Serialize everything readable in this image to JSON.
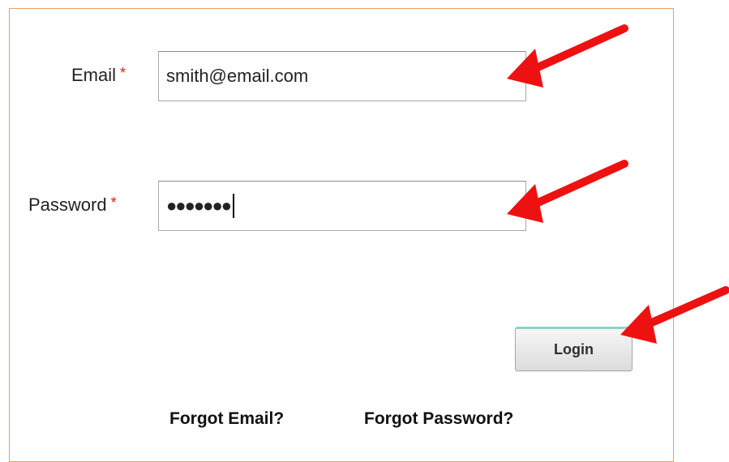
{
  "form": {
    "email_label": "Email",
    "password_label": "Password",
    "required_marker": "*",
    "email_value": "smith@email.com",
    "password_value": "●●●●●●●",
    "login_label": "Login",
    "forgot_email": "Forgot Email?",
    "forgot_password": "Forgot Password?"
  },
  "colors": {
    "frame_border": "#e8a25a",
    "required": "#e01818",
    "annotation_arrow": "#ee1111",
    "login_top_accent": "#8fd3c5"
  },
  "annotations": {
    "arrow_icon": "red-arrow-icon",
    "count": 3
  }
}
